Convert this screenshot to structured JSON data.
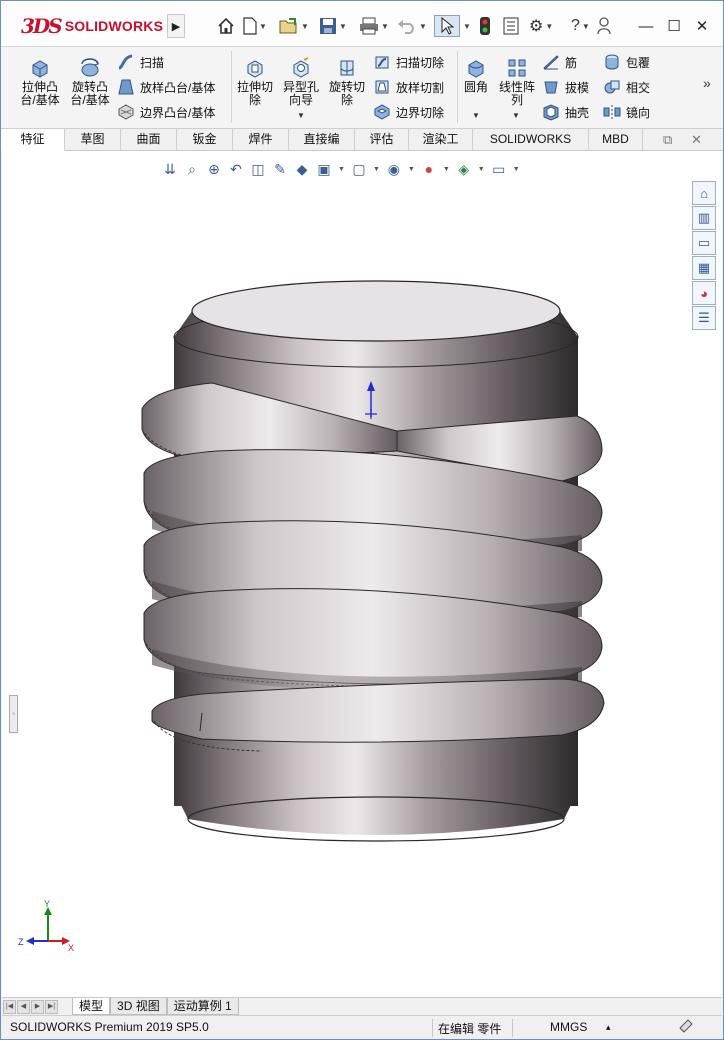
{
  "app": {
    "brand": "SOLIDWORKS",
    "brand_mark": "3DS"
  },
  "quick_access": {
    "icons": [
      "home-icon",
      "new-document-icon",
      "open-icon",
      "save-icon",
      "print-icon",
      "undo-icon",
      "select-icon",
      "rebuild-icon",
      "file-properties-icon",
      "options-icon",
      "help-icon",
      "user-icon"
    ]
  },
  "ribbon": {
    "extrude_boss": "拉伸凸\n台/基体",
    "revolve_boss": "旋转凸\n台/基体",
    "sweep_boss": "扫描",
    "loft_boss": "放样凸台/基体",
    "boundary_boss": "边界凸台/基体",
    "extrude_cut": "拉伸切\n除",
    "hole_wizard": "异型孔\n向导",
    "revolve_cut": "旋转切\n除",
    "sweep_cut": "扫描切除",
    "loft_cut": "放样切割",
    "boundary_cut": "边界切除",
    "fillet": "圆角",
    "linear_pattern": "线性阵\n列",
    "rib": "筋",
    "draft": "拔模",
    "shell": "抽壳",
    "wrap": "包覆",
    "intersect": "相交",
    "mirror": "镜向",
    "more": "»"
  },
  "tabs": [
    "特征",
    "草图",
    "曲面",
    "钣金",
    "焊件",
    "直接编辑",
    "评估",
    "渲染工具",
    "SOLIDWORKS 插件",
    "MBD"
  ],
  "active_tab": "特征",
  "triad": {
    "x": "X",
    "y": "Y",
    "z": "Z"
  },
  "bottom_tabs": [
    "模型",
    "3D 视图",
    "运动算例 1"
  ],
  "active_bottom_tab": "模型",
  "status": {
    "product": "SOLIDWORKS Premium 2019 SP5.0",
    "mode": "在编辑 零件",
    "units": "MMGS",
    "units_caret": "▴"
  },
  "colors": {
    "brand_red": "#c8102e",
    "window_border": "#6d8fbd",
    "part_metal": "#8a7f86",
    "triad_x": "#d11c1c",
    "triad_y": "#1b8a1b",
    "triad_z": "#1c2fd1"
  }
}
